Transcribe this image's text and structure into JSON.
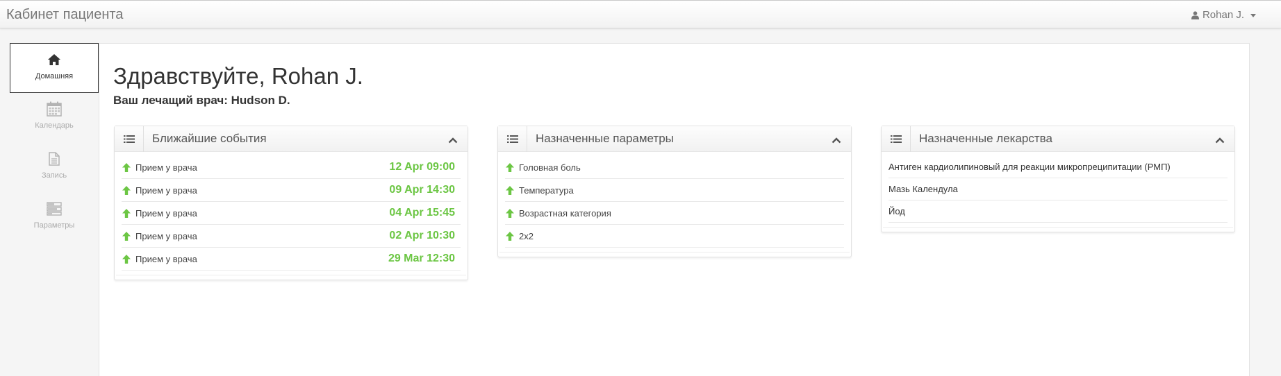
{
  "app": {
    "title": "Кабинет пациента"
  },
  "user_menu": {
    "name": "Rohan J."
  },
  "sidebar": {
    "items": [
      {
        "label": "Домашняя",
        "icon": "home-icon",
        "active": true
      },
      {
        "label": "Календарь",
        "icon": "calendar-icon",
        "active": false
      },
      {
        "label": "Запись",
        "icon": "document-icon",
        "active": false
      },
      {
        "label": "Параметры",
        "icon": "parameters-icon",
        "active": false
      }
    ]
  },
  "main": {
    "greeting": "Здравствуйте, Rohan J.",
    "doctor": "Ваш лечащий врач: Hudson D."
  },
  "widgets": {
    "events": {
      "title": "Ближайшие события",
      "items": [
        {
          "label": "Прием у врача",
          "time": "12 Apr 09:00"
        },
        {
          "label": "Прием у врача",
          "time": "09 Apr 14:30"
        },
        {
          "label": "Прием у врача",
          "time": "04 Apr 15:45"
        },
        {
          "label": "Прием у врача",
          "time": "02 Apr 10:30"
        },
        {
          "label": "Прием у врача",
          "time": "29 Mar 12:30"
        }
      ]
    },
    "parameters": {
      "title": "Назначенные параметры",
      "items": [
        {
          "label": "Головная боль"
        },
        {
          "label": "Температура"
        },
        {
          "label": "Возрастная категория"
        },
        {
          "label": "2x2"
        }
      ]
    },
    "medicines": {
      "title": "Назначенные лекарства",
      "items": [
        {
          "label": "Антиген кардиолипиновый для реакции микропреципитации (РМП)"
        },
        {
          "label": "Мазь Календула"
        },
        {
          "label": "Йод"
        }
      ]
    }
  },
  "colors": {
    "accent_green": "#6cc644",
    "text": "#333333",
    "muted": "#aaaaaa"
  }
}
